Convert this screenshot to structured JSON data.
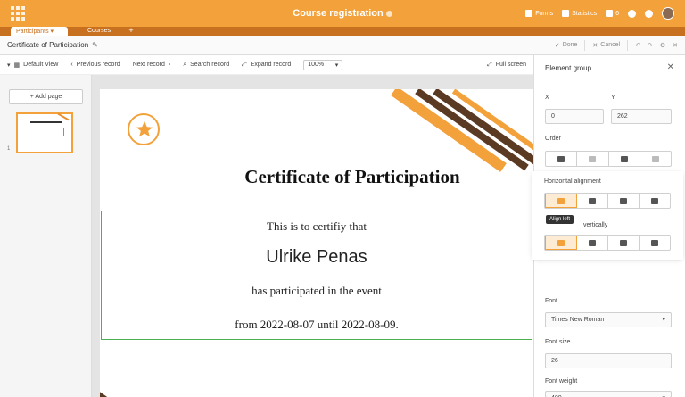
{
  "app": {
    "title": "Course registration",
    "tools": {
      "forms": "Forms",
      "statistics": "Statistics",
      "users_count": "6"
    }
  },
  "tabs": [
    {
      "label": "Participants ▾"
    },
    {
      "label": "Courses"
    }
  ],
  "dialog": {
    "title": "Certificate of Participation",
    "done": "Done",
    "cancel": "Cancel"
  },
  "toolbar": {
    "view": "Default View",
    "prev": "Previous record",
    "next": "Next record",
    "search": "Search record",
    "expand": "Expand record",
    "zoom": "100%",
    "fullscreen": "Full screen"
  },
  "pages": {
    "add": "+ Add page",
    "page_number": "1"
  },
  "certificate": {
    "title": "Certificate of Participation",
    "line1": "This is to certifiy that",
    "name": "Ulrike Penas",
    "line2": "has participated in the event",
    "line3": "from 2022-08-07 until 2022-08-09."
  },
  "panel": {
    "header": "Element group",
    "x_label": "X",
    "x_value": "0",
    "y_label": "Y",
    "y_value": "262",
    "order_label": "Order",
    "h_align_label": "Horizontal alignment",
    "tooltip": "Align left",
    "v_align_label": "vertically",
    "font_label": "Font",
    "font_value": "Times New Roman",
    "font_size_label": "Font size",
    "font_size_value": "26",
    "font_weight_label": "Font weight",
    "font_weight_value": "400"
  },
  "colors": {
    "accent": "#f3a13a",
    "brown": "#5b3a24",
    "group_border": "#4caf50"
  }
}
